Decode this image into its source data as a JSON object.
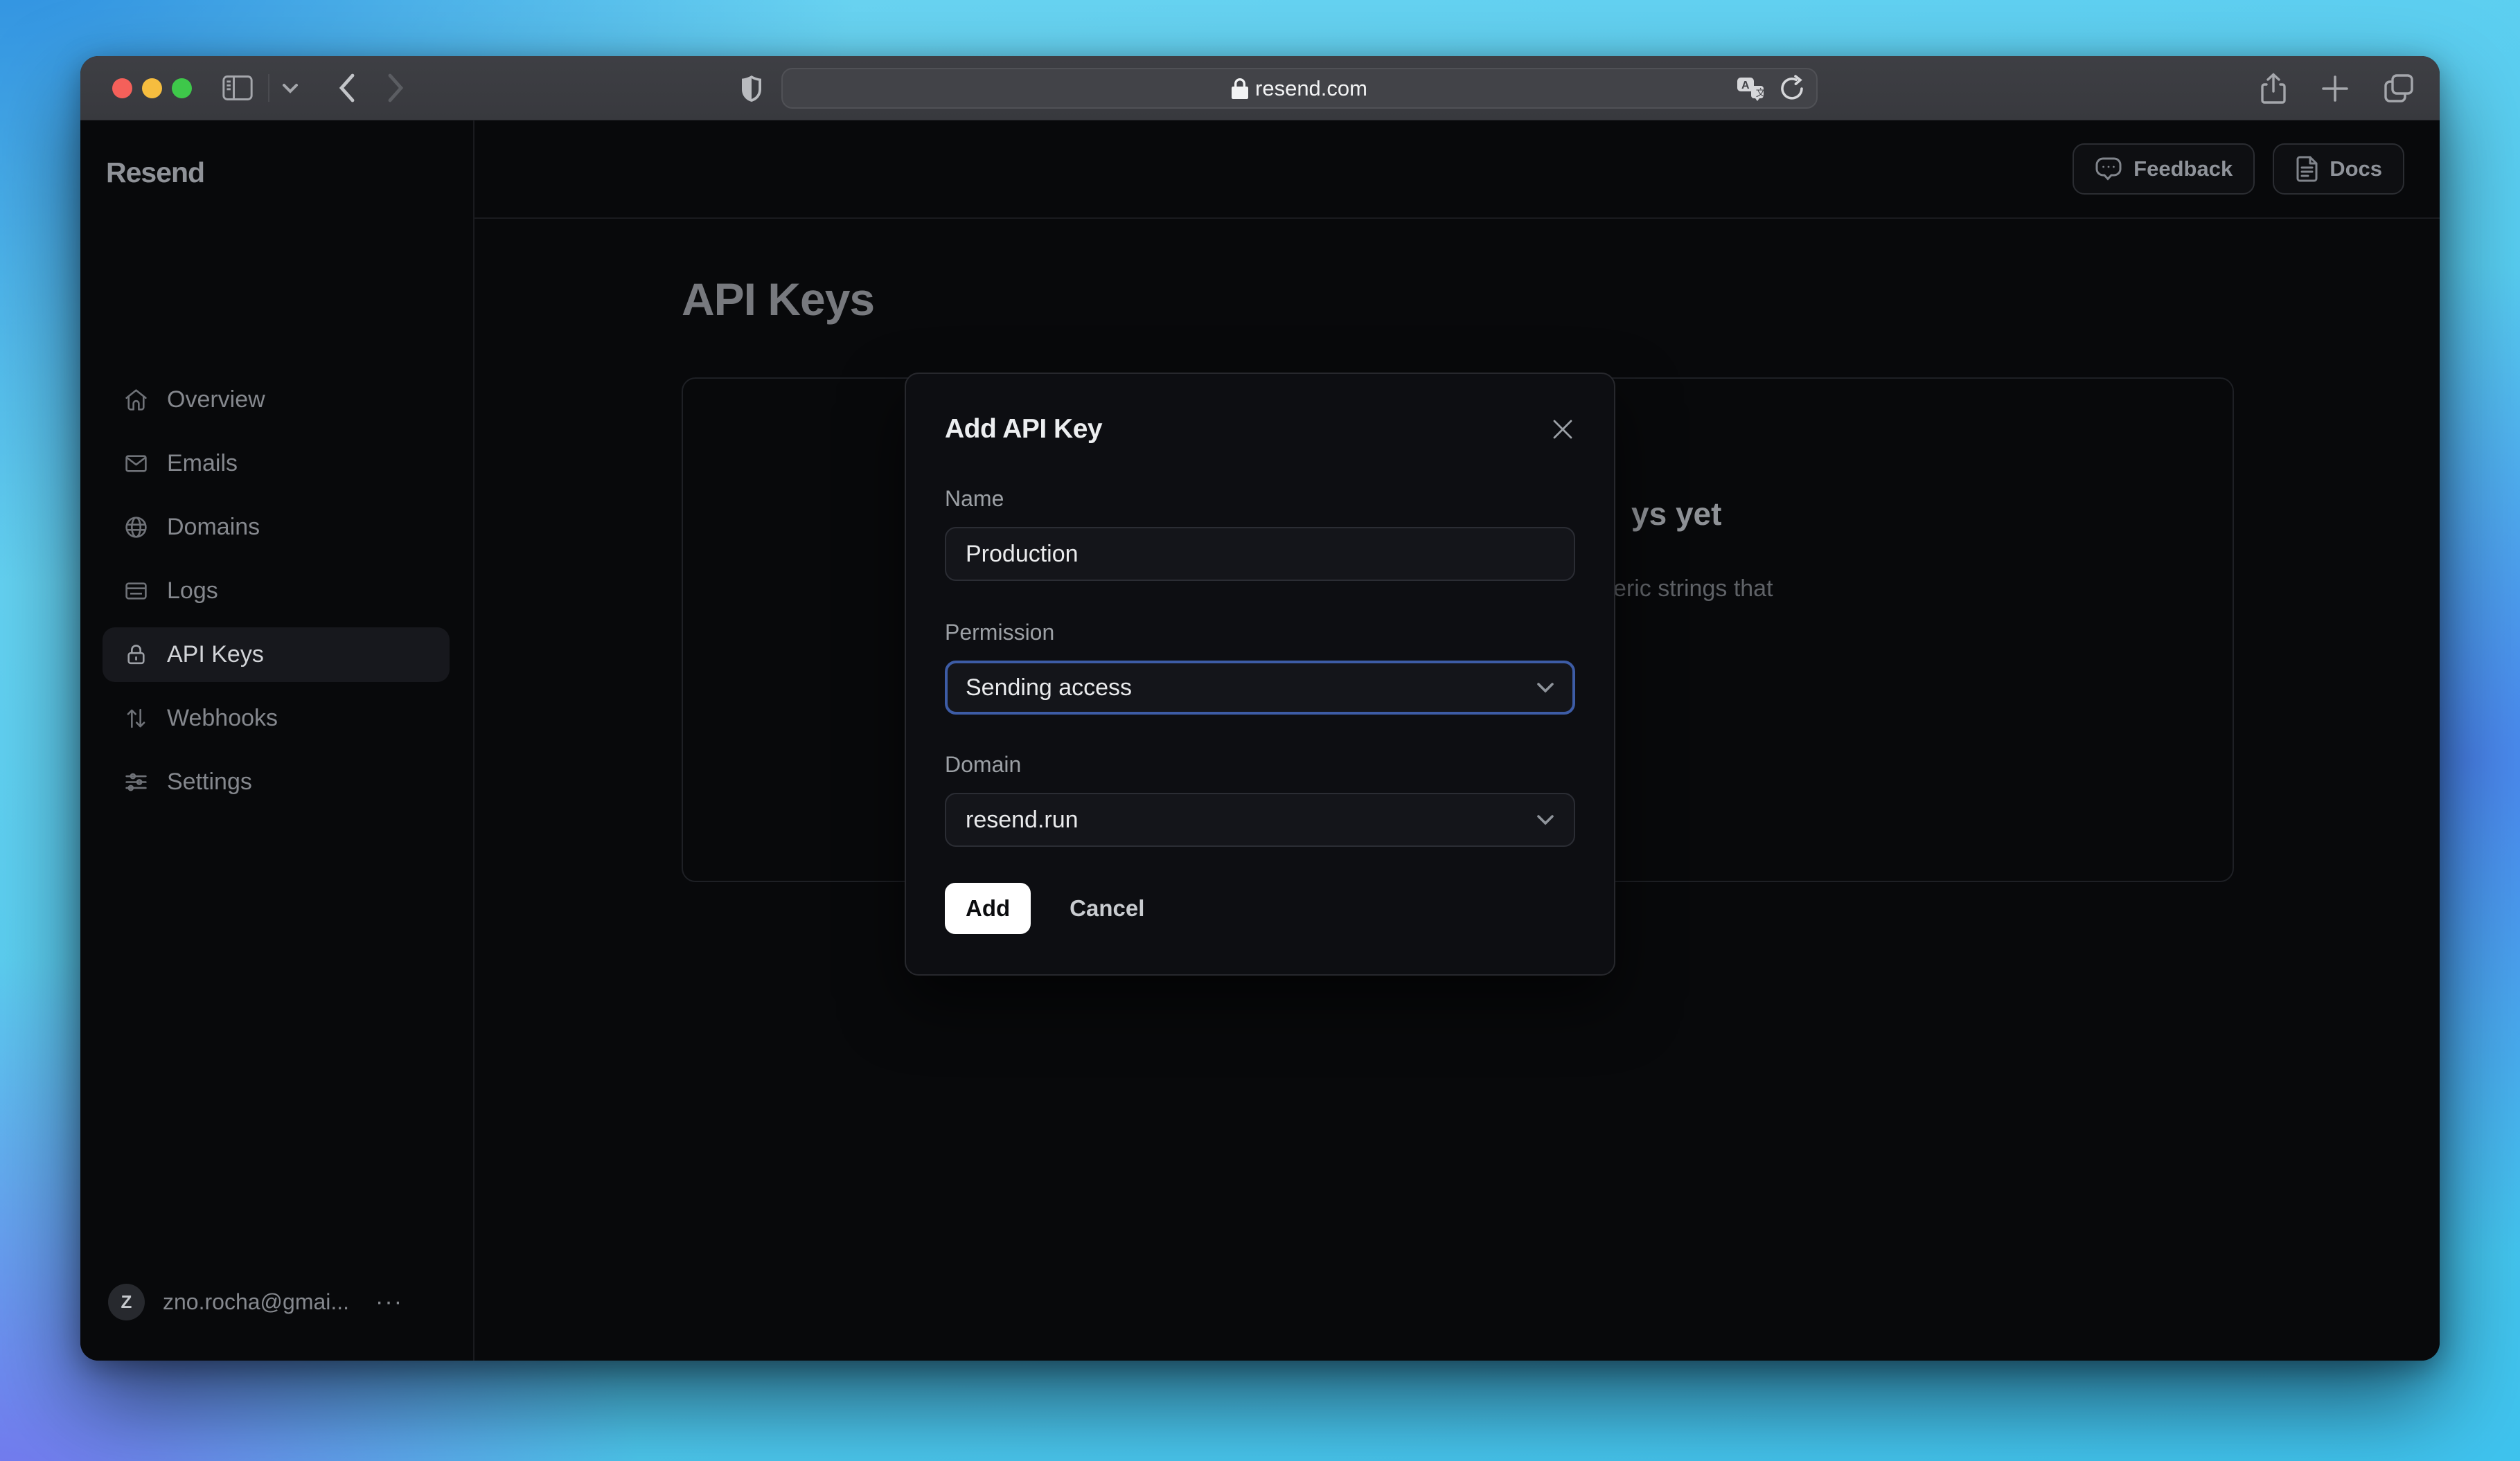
{
  "browser": {
    "url": "resend.com",
    "window_controls": [
      "close",
      "minimize",
      "zoom"
    ],
    "toolbar_icons": [
      "sidebar-toggle",
      "chevron-down",
      "back",
      "forward",
      "shield",
      "lock",
      "translate",
      "reload",
      "share",
      "new-tab",
      "tab-overview"
    ]
  },
  "sidebar": {
    "logo": "Resend",
    "items": [
      {
        "label": "Overview",
        "icon": "home-icon",
        "active": false
      },
      {
        "label": "Emails",
        "icon": "mail-icon",
        "active": false
      },
      {
        "label": "Domains",
        "icon": "globe-icon",
        "active": false
      },
      {
        "label": "Logs",
        "icon": "logs-icon",
        "active": false
      },
      {
        "label": "API Keys",
        "icon": "lock-icon",
        "active": true
      },
      {
        "label": "Webhooks",
        "icon": "arrows-icon",
        "active": false
      },
      {
        "label": "Settings",
        "icon": "sliders-icon",
        "active": false
      }
    ],
    "user": {
      "avatar_letter": "Z",
      "email": "zno.rocha@gmai...",
      "more": "···"
    }
  },
  "header": {
    "feedback_label": "Feedback",
    "docs_label": "Docs"
  },
  "page": {
    "title": "API Keys",
    "empty_state": {
      "heading_fragment": "ys yet",
      "body_fragment": "eric strings that"
    }
  },
  "modal": {
    "title": "Add API Key",
    "fields": [
      {
        "label": "Name",
        "type": "input",
        "value": "Production"
      },
      {
        "label": "Permission",
        "type": "select",
        "value": "Sending access"
      },
      {
        "label": "Domain",
        "type": "select",
        "value": "resend.run"
      }
    ],
    "add_label": "Add",
    "cancel_label": "Cancel"
  },
  "colors": {
    "grad-blue": "#2e8fe0",
    "grad-purple": "#7673ee",
    "grad-midblue": "#4a85ed",
    "grad-cyan-tr": "#6fd6f2",
    "grad-cyan-br": "#3fc3ee",
    "window-bg": "#08090b",
    "divider": "#1a1b1f",
    "pill": "#17181d",
    "modal-bg": "#0d0e12",
    "modal-border": "#27282d",
    "control-bg": "#14151a",
    "control-border": "#2b2d34",
    "focus-ring": "#3d5ca6"
  }
}
